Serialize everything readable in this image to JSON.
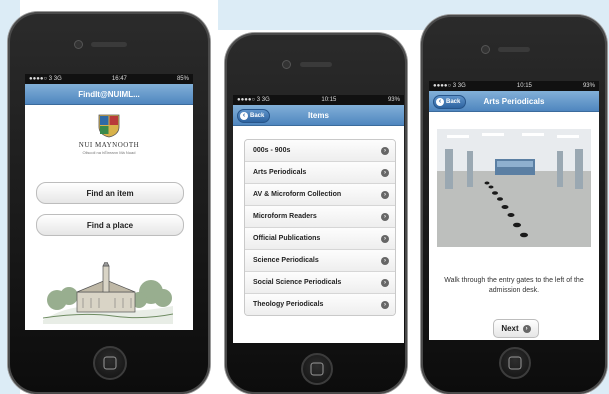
{
  "colors": {
    "navbar": "#5c92c8",
    "background_panel": "#dcecf6"
  },
  "phone1": {
    "status": {
      "carrier": "●●●●○ 3 3G",
      "time": "16:47",
      "battery": "85%"
    },
    "title": "FindIt@NUIML...",
    "logo_text": "NUI MAYNOOTH",
    "logo_subtext": "Ollscoil na hÉireann Má Nuad",
    "buttons": [
      "Find an item",
      "Find a place"
    ]
  },
  "phone2": {
    "status": {
      "carrier": "●●●●○ 3 3G",
      "time": "10:15",
      "battery": "93%"
    },
    "back_label": "Back",
    "title": "Items",
    "items": [
      "000s - 900s",
      "Arts Periodicals",
      "AV & Microform Collection",
      "Microform Readers",
      "Official Publications",
      "Science Periodicals",
      "Social Science Periodicals",
      "Theology Periodicals"
    ]
  },
  "phone3": {
    "status": {
      "carrier": "●●●●○ 3 3G",
      "time": "10:15",
      "battery": "93%"
    },
    "back_label": "Back",
    "title": "Arts Periodicals",
    "instruction": "Walk through the entry gates to the left of the admission desk.",
    "next_label": "Next"
  }
}
